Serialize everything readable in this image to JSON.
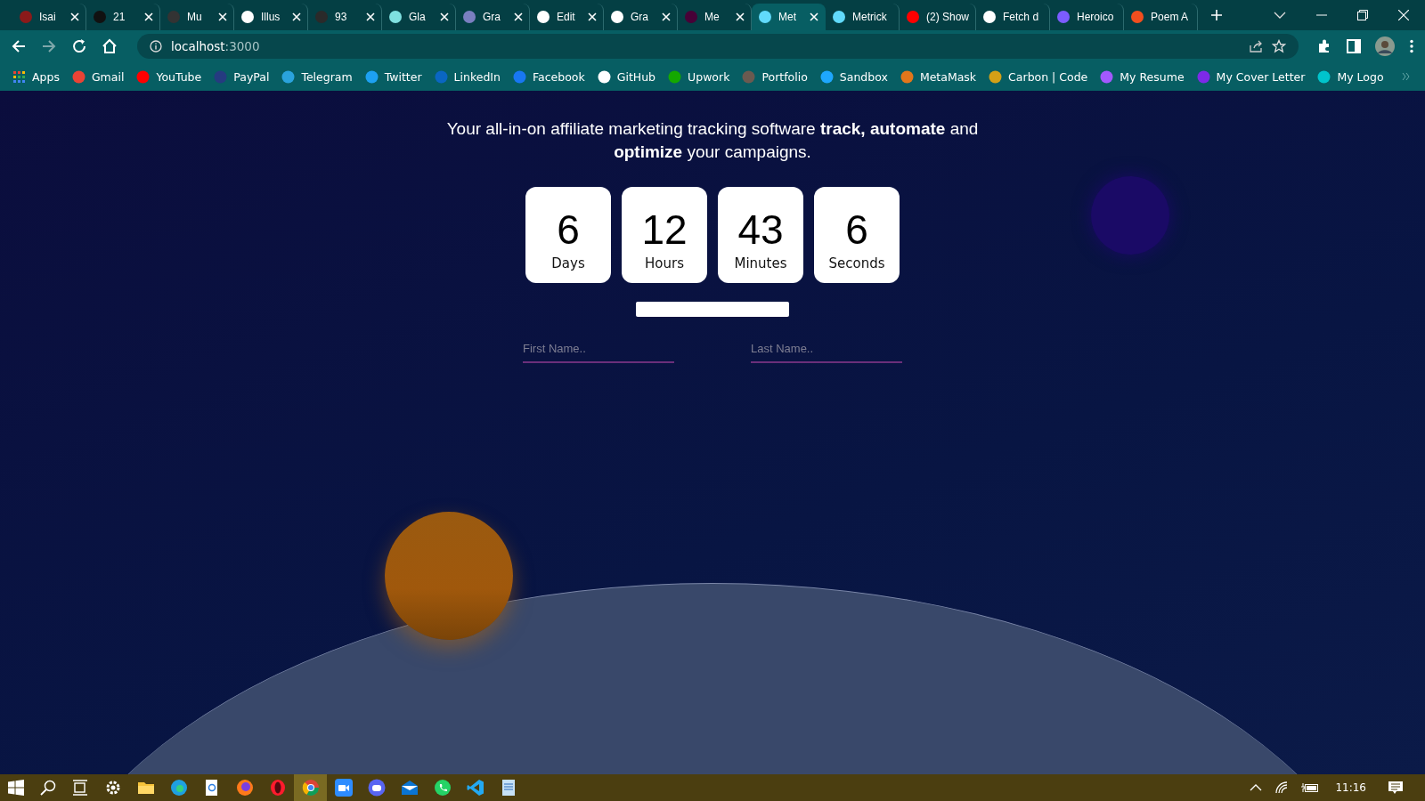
{
  "browser": {
    "tabs": [
      {
        "title": "Isai",
        "selected": false,
        "closable": true
      },
      {
        "title": "21",
        "selected": false,
        "closable": true
      },
      {
        "title": "Mu",
        "selected": false,
        "closable": true
      },
      {
        "title": "Illus",
        "selected": false,
        "closable": true
      },
      {
        "title": "93",
        "selected": false,
        "closable": true
      },
      {
        "title": "Gla",
        "selected": false,
        "closable": true
      },
      {
        "title": "Gra",
        "selected": false,
        "closable": true
      },
      {
        "title": "Edit",
        "selected": false,
        "closable": true
      },
      {
        "title": "Gra",
        "selected": false,
        "closable": true
      },
      {
        "title": "Me",
        "selected": false,
        "closable": true
      },
      {
        "title": "Met",
        "selected": true,
        "closable": true
      },
      {
        "title": "Metrick",
        "selected": false,
        "closable": false
      },
      {
        "title": "(2) Show",
        "selected": false,
        "closable": false
      },
      {
        "title": "Fetch d",
        "selected": false,
        "closable": false
      },
      {
        "title": "Heroico",
        "selected": false,
        "closable": false
      },
      {
        "title": "Poem A",
        "selected": false,
        "closable": false
      }
    ],
    "address": {
      "host": "localhost",
      "port": ":3000"
    },
    "bookmarks": [
      "Apps",
      "Gmail",
      "YouTube",
      "PayPal",
      "Telegram",
      "Twitter",
      "LinkedIn",
      "Facebook",
      "GitHub",
      "Upwork",
      "Portfolio",
      "Sandbox",
      "MetaMask",
      "Carbon | Code",
      "My Resume",
      "My Cover Letter",
      "My Logo"
    ]
  },
  "page": {
    "headline": "Your all-in-on affiliate marketing tracking software **track, automate** and **optimize** your campaigns.",
    "countdown": [
      {
        "value": "6",
        "label": "Days"
      },
      {
        "value": "12",
        "label": "Hours"
      },
      {
        "value": "43",
        "label": "Minutes"
      },
      {
        "value": "6",
        "label": "Seconds"
      }
    ],
    "fields": [
      {
        "placeholder": "First Name.."
      },
      {
        "placeholder": "Last Name.."
      }
    ]
  },
  "taskbar": {
    "apps": [
      {
        "active": false
      },
      {
        "active": false
      },
      {
        "active": false
      },
      {
        "active": false
      },
      {
        "active": false
      },
      {
        "active": false
      },
      {
        "active": true
      },
      {
        "active": false
      },
      {
        "active": false
      },
      {
        "active": false
      },
      {
        "active": false
      },
      {
        "active": false
      },
      {
        "active": false
      }
    ],
    "time": "11:16"
  }
}
